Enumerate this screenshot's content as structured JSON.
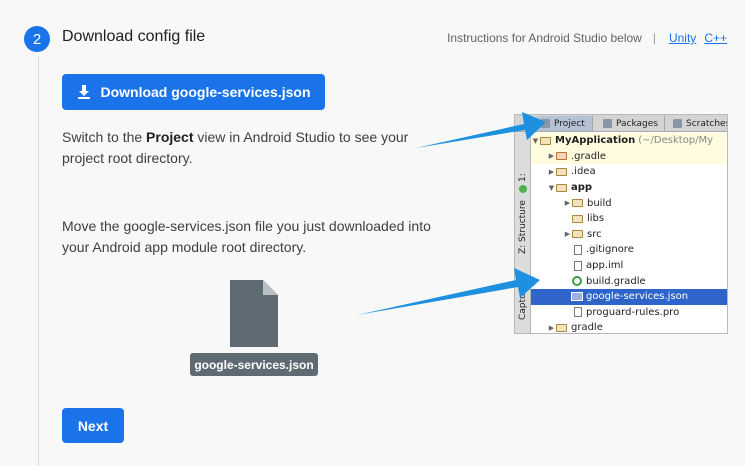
{
  "step": {
    "number": "2",
    "title": "Download config file",
    "instructions_note": "Instructions for Android Studio below",
    "separator": "|",
    "links": [
      "Unity",
      "C++"
    ]
  },
  "download_button": {
    "label": "Download google-services.json",
    "icon": "download-icon"
  },
  "paragraph1": {
    "before": "Switch to the ",
    "bold": "Project",
    "after": " view in Android Studio to see your project root directory."
  },
  "paragraph2": {
    "text": "Move the google-services.json file you just downloaded into your Android app module root directory."
  },
  "file_badge": {
    "label": "google-services.json",
    "icon": "file-icon"
  },
  "next_button": {
    "label": "Next"
  },
  "ide": {
    "tabs": [
      "Project",
      "Packages",
      "Scratches"
    ],
    "side_labels": [
      "1:",
      "Z: Structure",
      "Captures"
    ],
    "tree": [
      {
        "label": "MyApplication",
        "suffix": "(~/Desktop/My",
        "kind": "root"
      },
      {
        "label": ".gradle",
        "kind": "folder-orange"
      },
      {
        "label": ".idea",
        "kind": "folder"
      },
      {
        "label": "app",
        "kind": "app"
      },
      {
        "label": "build",
        "kind": "folder"
      },
      {
        "label": "libs",
        "kind": "folder"
      },
      {
        "label": "src",
        "kind": "folder"
      },
      {
        "label": ".gitignore",
        "kind": "file"
      },
      {
        "label": "app.iml",
        "kind": "file"
      },
      {
        "label": "build.gradle",
        "kind": "gradle"
      },
      {
        "label": "google-services.json",
        "kind": "json"
      },
      {
        "label": "proguard-rules.pro",
        "kind": "file"
      },
      {
        "label": "gradle",
        "kind": "folder"
      }
    ]
  },
  "colors": {
    "accent": "#1a73e8",
    "arrow": "#1e90e0",
    "selection": "#2f65ca"
  }
}
